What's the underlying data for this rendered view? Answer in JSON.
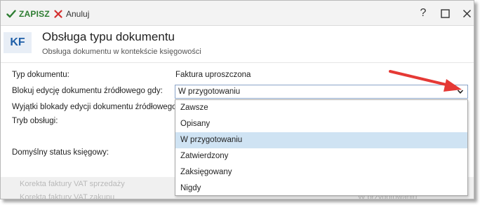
{
  "toolbar": {
    "save_label": "ZAPISZ",
    "cancel_label": "Anuluj",
    "help_label": "?"
  },
  "header": {
    "badge": "KF",
    "title": "Obsługa typu dokumentu",
    "subtitle": "Obsługa dokumentu w kontekście księgowości"
  },
  "form": {
    "document_type_label": "Typ dokumentu:",
    "document_type_value": "Faktura uproszczona",
    "block_edit_label": "Blokuj edycję dokumentu źródłowego gdy:",
    "block_edit_value": "W przygotowaniu",
    "exceptions_label": "Wyjątki blokady edycji dokumentu źródłowego:",
    "mode_label": "Tryb obsługi:",
    "default_status_label": "Domyślny status księgowy:"
  },
  "dropdown": {
    "options": [
      "Zawsze",
      "Opisany",
      "W przygotowaniu",
      "Zatwierdzony",
      "Zaksięgowany",
      "Nigdy"
    ],
    "selected_index": 2
  },
  "background_rows": {
    "row1": "Korekta faktury VAT sprzedaży",
    "row2": "Korekta faktury VAT zakupu",
    "row2_value": "W przygotowaniu"
  },
  "colors": {
    "save_green": "#2e7d32",
    "cancel_red": "#d32f2f",
    "badge_blue": "#1f5fa8",
    "selected_row": "#cfe3f3",
    "arrow_red": "#e53935"
  }
}
